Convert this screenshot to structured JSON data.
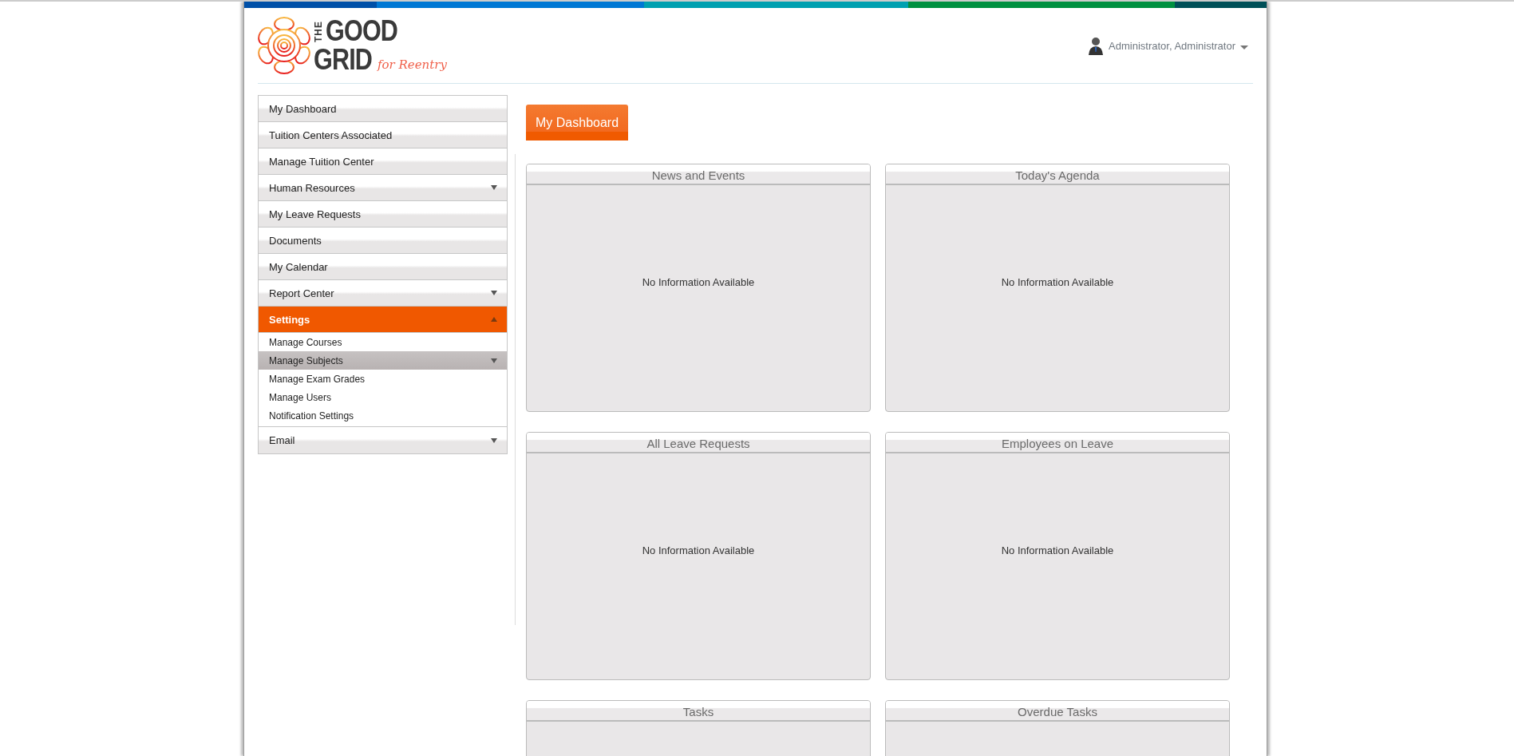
{
  "header": {
    "logo": {
      "word_1": "THE",
      "word_2": "GOOD",
      "word_3": "GRID",
      "tagline": "for Reentry"
    },
    "user": {
      "name": "Administrator, Administrator"
    }
  },
  "sidebar": {
    "items": [
      {
        "label": "My Dashboard",
        "kind": "link",
        "selected": false
      },
      {
        "label": "Tuition Centers Associated",
        "kind": "link",
        "selected": false
      },
      {
        "label": "Manage Tuition Center",
        "kind": "link",
        "selected": false
      },
      {
        "label": "Human Resources",
        "kind": "dropdown",
        "selected": false,
        "expanded": false
      },
      {
        "label": "My Leave Requests",
        "kind": "link",
        "selected": false
      },
      {
        "label": "Documents",
        "kind": "link",
        "selected": false
      },
      {
        "label": "My Calendar",
        "kind": "link",
        "selected": false
      },
      {
        "label": "Report Center",
        "kind": "dropdown",
        "selected": false,
        "expanded": false
      },
      {
        "label": "Settings",
        "kind": "dropdown",
        "selected": true,
        "expanded": true,
        "children": [
          {
            "label": "Manage Courses",
            "kind": "link",
            "selected": false
          },
          {
            "label": "Manage Subjects",
            "kind": "dropdown",
            "selected": true,
            "expanded": false
          },
          {
            "label": "Manage Exam Grades",
            "kind": "link",
            "selected": false
          },
          {
            "label": "Manage Users",
            "kind": "link",
            "selected": false
          },
          {
            "label": "Notification Settings",
            "kind": "link",
            "selected": false
          }
        ]
      },
      {
        "label": "Email",
        "kind": "dropdown",
        "selected": false,
        "expanded": false
      }
    ]
  },
  "page_title": "My Dashboard",
  "panels": [
    {
      "title": "News and Events",
      "message": "No Information Available"
    },
    {
      "title": "Today's Agenda",
      "message": "No Information Available"
    },
    {
      "title": "All Leave Requests",
      "message": "No Information Available"
    },
    {
      "title": "Employees on Leave",
      "message": "No Information Available"
    },
    {
      "title": "Tasks"
    },
    {
      "title": "Overdue Tasks"
    }
  ]
}
